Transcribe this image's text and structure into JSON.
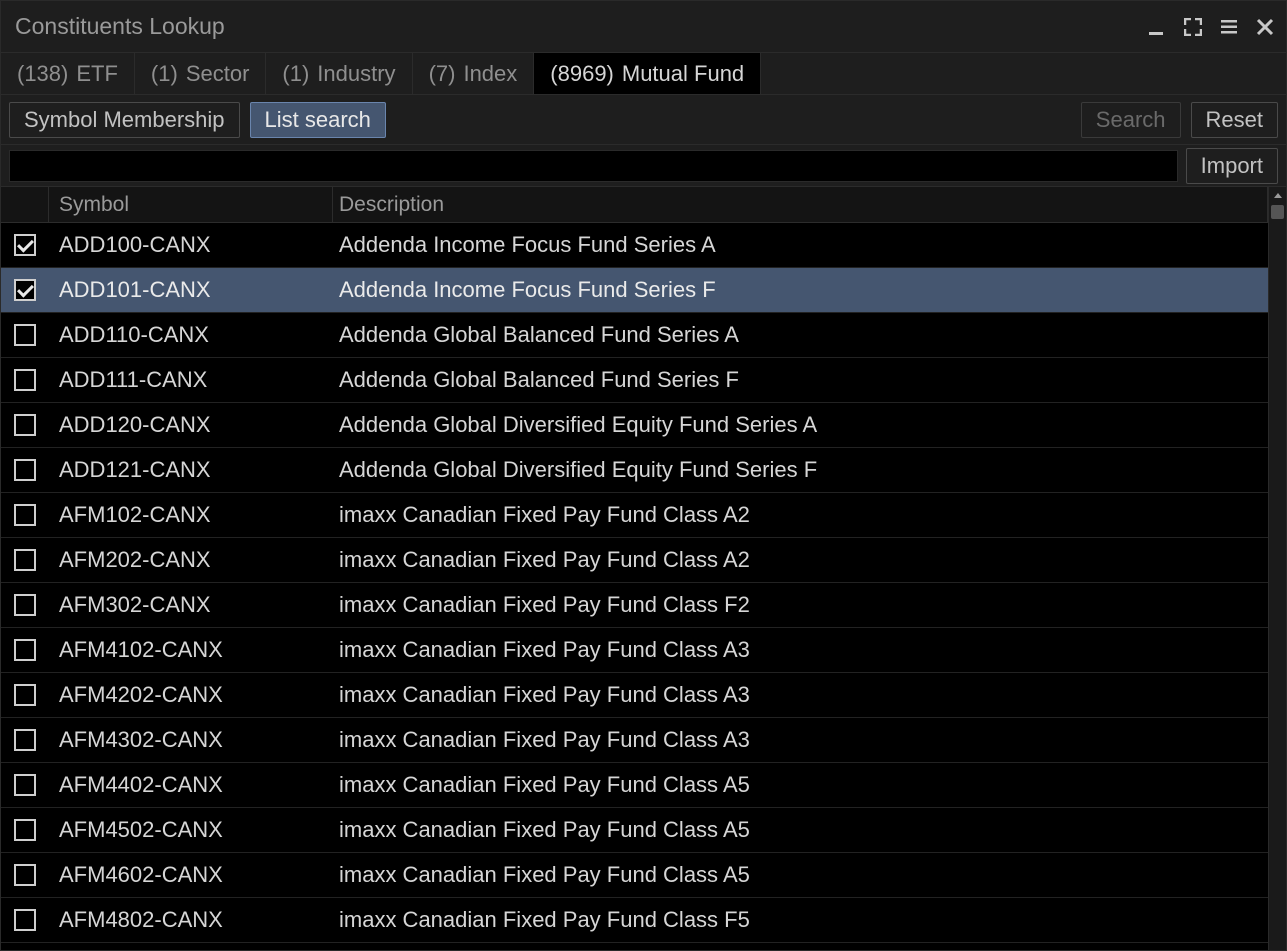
{
  "title": "Constituents Lookup",
  "tabs": [
    {
      "count": "(138)",
      "label": "ETF",
      "active": false
    },
    {
      "count": "(1)",
      "label": "Sector",
      "active": false
    },
    {
      "count": "(1)",
      "label": "Industry",
      "active": false
    },
    {
      "count": "(7)",
      "label": "Index",
      "active": false
    },
    {
      "count": "(8969)",
      "label": "Mutual Fund",
      "active": true
    }
  ],
  "toolbar": {
    "symbol_membership_label": "Symbol Membership",
    "list_search_label": "List search",
    "search_button_label": "Search",
    "reset_button_label": "Reset",
    "import_button_label": "Import"
  },
  "search_value": "",
  "columns": {
    "symbol_header": "Symbol",
    "description_header": "Description"
  },
  "rows": [
    {
      "checked": true,
      "selected": false,
      "symbol": "ADD100-CANX",
      "description": "Addenda Income Focus Fund Series A"
    },
    {
      "checked": true,
      "selected": true,
      "symbol": "ADD101-CANX",
      "description": "Addenda Income Focus Fund Series F"
    },
    {
      "checked": false,
      "selected": false,
      "symbol": "ADD110-CANX",
      "description": "Addenda Global Balanced Fund Series A"
    },
    {
      "checked": false,
      "selected": false,
      "symbol": "ADD111-CANX",
      "description": "Addenda Global Balanced Fund Series F"
    },
    {
      "checked": false,
      "selected": false,
      "symbol": "ADD120-CANX",
      "description": "Addenda Global Diversified Equity Fund Series A"
    },
    {
      "checked": false,
      "selected": false,
      "symbol": "ADD121-CANX",
      "description": "Addenda Global Diversified Equity Fund Series F"
    },
    {
      "checked": false,
      "selected": false,
      "symbol": "AFM102-CANX",
      "description": "imaxx Canadian Fixed Pay Fund Class A2"
    },
    {
      "checked": false,
      "selected": false,
      "symbol": "AFM202-CANX",
      "description": "imaxx Canadian Fixed Pay Fund Class A2"
    },
    {
      "checked": false,
      "selected": false,
      "symbol": "AFM302-CANX",
      "description": "imaxx Canadian Fixed Pay Fund Class F2"
    },
    {
      "checked": false,
      "selected": false,
      "symbol": "AFM4102-CANX",
      "description": "imaxx Canadian Fixed Pay Fund Class A3"
    },
    {
      "checked": false,
      "selected": false,
      "symbol": "AFM4202-CANX",
      "description": "imaxx Canadian Fixed Pay Fund Class A3"
    },
    {
      "checked": false,
      "selected": false,
      "symbol": "AFM4302-CANX",
      "description": "imaxx Canadian Fixed Pay Fund Class A3"
    },
    {
      "checked": false,
      "selected": false,
      "symbol": "AFM4402-CANX",
      "description": "imaxx Canadian Fixed Pay Fund Class A5"
    },
    {
      "checked": false,
      "selected": false,
      "symbol": "AFM4502-CANX",
      "description": "imaxx Canadian Fixed Pay Fund Class A5"
    },
    {
      "checked": false,
      "selected": false,
      "symbol": "AFM4602-CANX",
      "description": "imaxx Canadian Fixed Pay Fund Class A5"
    },
    {
      "checked": false,
      "selected": false,
      "symbol": "AFM4802-CANX",
      "description": "imaxx Canadian Fixed Pay Fund Class F5"
    }
  ]
}
